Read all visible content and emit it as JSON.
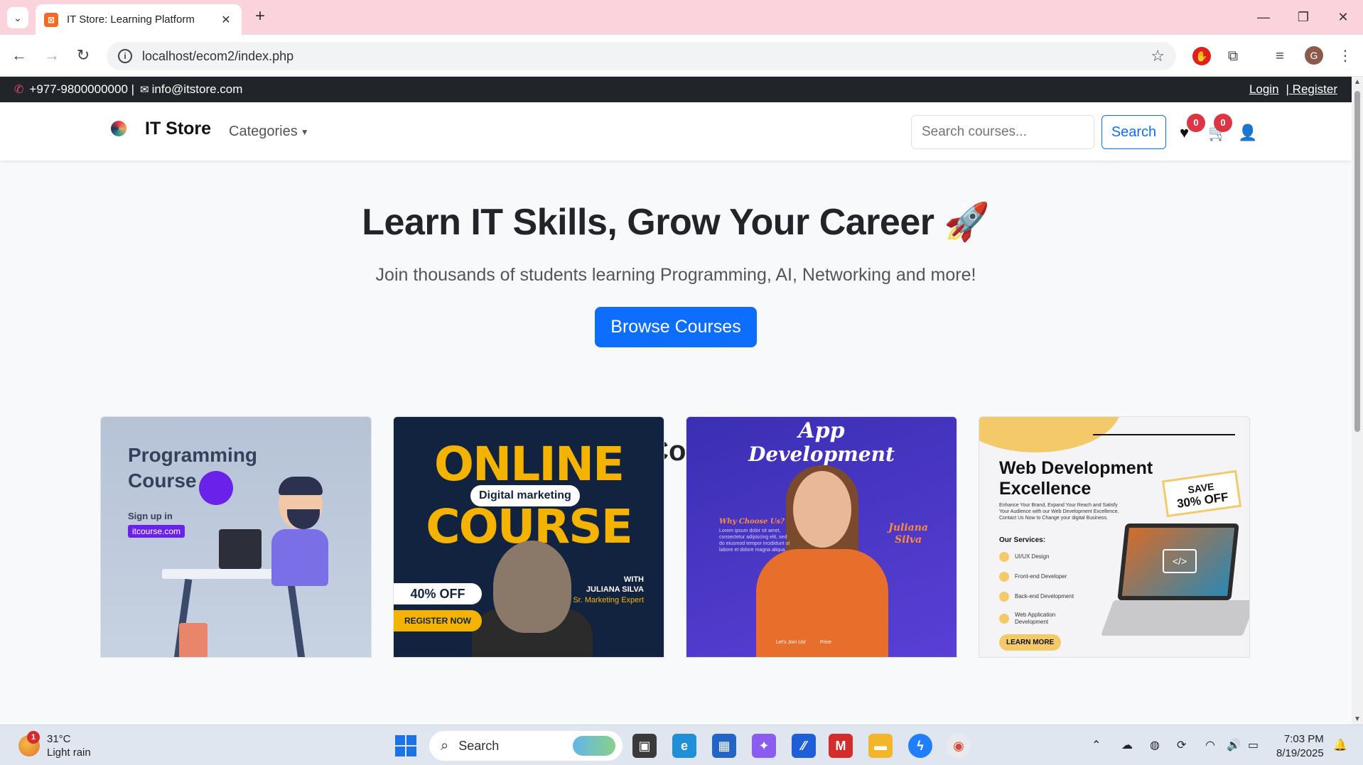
{
  "browser": {
    "tab_title": "IT Store: Learning Platform",
    "url": "localhost/ecom2/index.php",
    "profile_initial": "G"
  },
  "topbar": {
    "phone": "+977-9800000000 |",
    "email": "info@itstore.com",
    "login": "Login",
    "register": "| Register"
  },
  "navbar": {
    "brand": "IT Store",
    "categories": "Categories",
    "search_placeholder": "Search courses...",
    "search_button": "Search",
    "wishlist_count": "0",
    "cart_count": "0"
  },
  "hero": {
    "title": "Learn IT Skills, Grow Your Career 🚀",
    "subtitle": "Join thousands of students learning Programming, AI, Networking and more!",
    "button": "Browse Courses"
  },
  "courses": {
    "heading": "Our Courses",
    "cards": [
      {
        "title_line1": "Programming",
        "title_line2": "Course",
        "signup": "Sign up in",
        "url": "itcourse.com"
      },
      {
        "big1": "ONLINE",
        "pill": "Digital marketing",
        "big2": "COURSE",
        "offer": "40% OFF",
        "register": "REGISTER NOW",
        "with": "WITH",
        "instructor": "JULIANA SILVA",
        "role": "Sr. Marketing Expert"
      },
      {
        "title_line1": "App",
        "title_line2": "Development",
        "why": "Why Choose Us?",
        "lorem": "Lorem ipsum dolor sit amet, consectetur adipiscing elit, sed do eiusmod tempor incididunt ut labore et dolore magna aliqua.",
        "name_line1": "Juliana",
        "name_line2": "Silva",
        "join": "Let's Join Us!",
        "price": "Price"
      },
      {
        "title_line1": "Web Development",
        "title_line2": "Excellence",
        "desc": "Enhance Your Brand, Expand Your Reach and Satisfy Your Audience with our Web Development Excellence. Contact Us Now to Change your digital Business.",
        "services_heading": "Our Services:",
        "services": [
          "UI/UX Design",
          "Front-end Developer",
          "Back-end Development",
          "Web Application Development"
        ],
        "save_line1": "SAVE",
        "save_line2": "30% OFF",
        "learn_more": "LEARN MORE"
      }
    ]
  },
  "taskbar": {
    "weather_temp": "31°C",
    "weather_desc": "Light rain",
    "weather_alerts": "1",
    "search": "Search",
    "time": "7:03 PM",
    "date": "8/19/2025"
  }
}
